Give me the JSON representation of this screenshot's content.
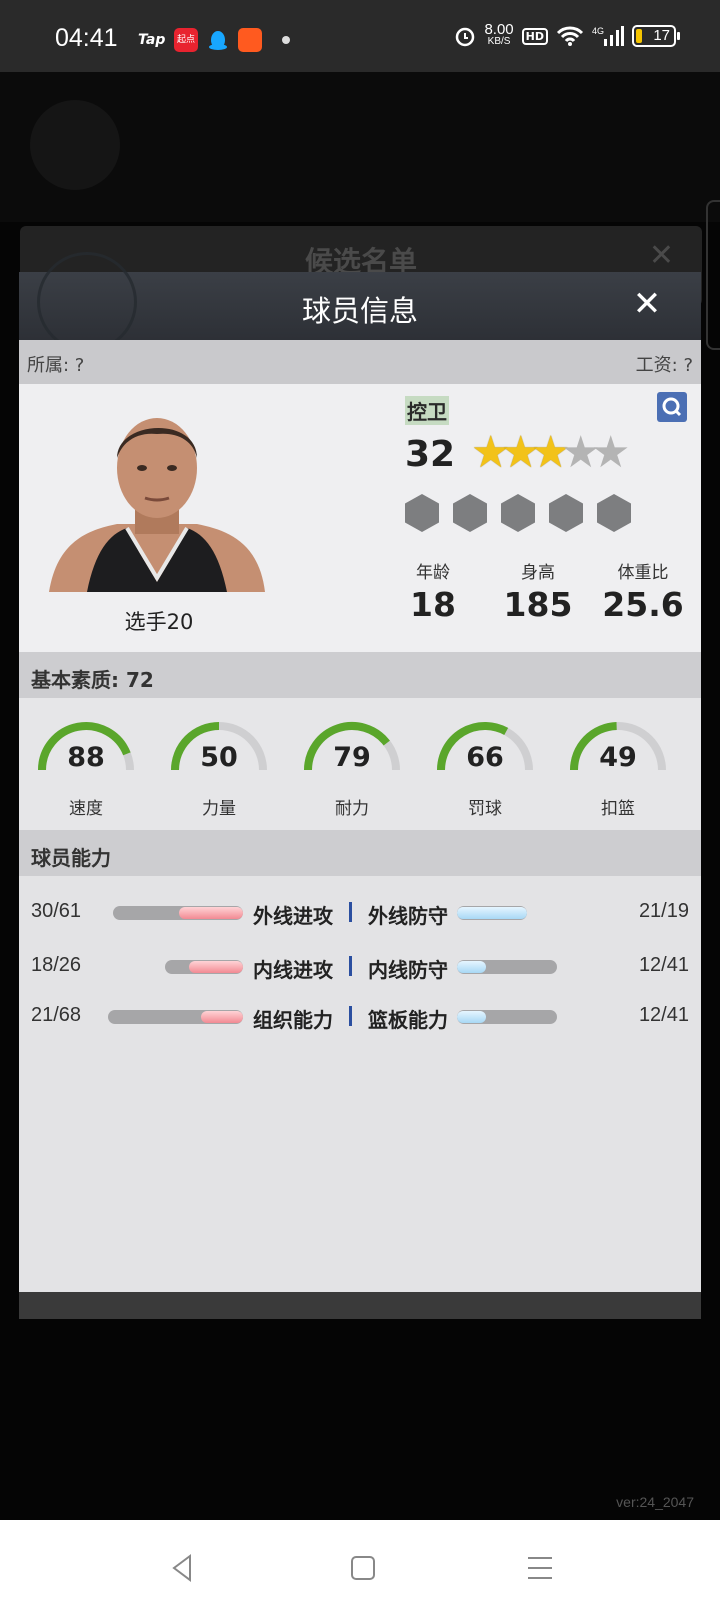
{
  "status_bar": {
    "time": "04:41",
    "apps": [
      "Tap",
      "起点",
      "QQ",
      "淘宝"
    ],
    "net_speed_value": "8.00",
    "net_speed_unit": "KB/S",
    "hd": "HD",
    "network": "4G",
    "battery": "17"
  },
  "background": {
    "panel_title": "候选名单",
    "version": "ver:24_2047"
  },
  "modal": {
    "title": "球员信息",
    "affiliation": "所属: ?",
    "salary": "工资: ?",
    "player": {
      "name": "选手20",
      "position": "控卫",
      "overall": "32",
      "stars": {
        "filled": 3,
        "total": 5
      },
      "badge_slots": 5,
      "attributes": [
        {
          "label": "年龄",
          "value": "18"
        },
        {
          "label": "身高",
          "value": "185"
        },
        {
          "label": "体重比",
          "value": "25.6"
        }
      ]
    },
    "basic_quality": {
      "header": "基本素质: 72",
      "gauges": [
        {
          "label": "速度",
          "value": 88
        },
        {
          "label": "力量",
          "value": 50
        },
        {
          "label": "耐力",
          "value": 79
        },
        {
          "label": "罚球",
          "value": 66
        },
        {
          "label": "扣篮",
          "value": 49
        }
      ]
    },
    "abilities": {
      "header": "球员能力",
      "rows": [
        {
          "left_label": "外线进攻",
          "left_value": "30/61",
          "left_fill": 0.49,
          "right_label": "外线防守",
          "right_value": "21/19",
          "right_fill": 1.0
        },
        {
          "left_label": "内线进攻",
          "left_value": "18/26",
          "left_fill": 0.69,
          "right_label": "内线防守",
          "right_value": "12/41",
          "right_fill": 0.29
        },
        {
          "left_label": "组织能力",
          "left_value": "21/68",
          "left_fill": 0.31,
          "right_label": "篮板能力",
          "right_value": "12/41",
          "right_fill": 0.29
        }
      ]
    }
  },
  "colors": {
    "gauge_green": "#5aa62b",
    "gauge_track": "#cfcfd1",
    "attack_fill": "#f28a93",
    "defense_fill": "#a8d8f5",
    "divider_blue": "#2b4fa0"
  }
}
